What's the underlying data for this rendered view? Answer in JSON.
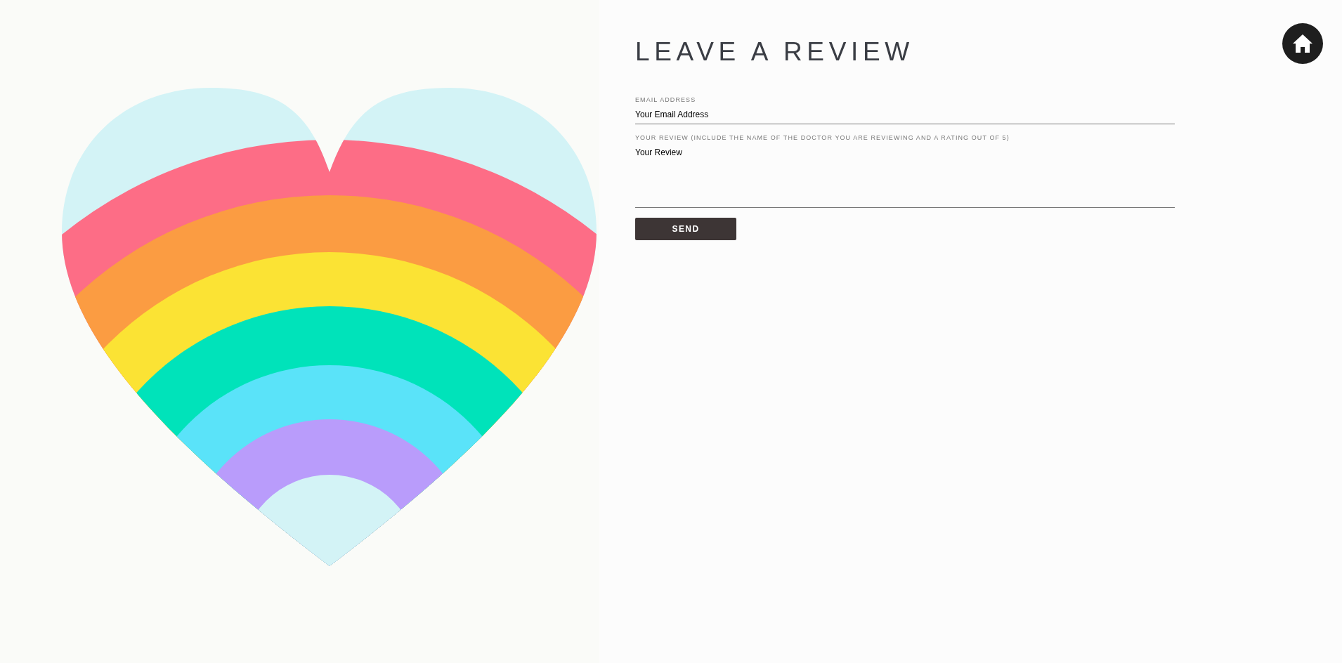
{
  "heading": "LEAVE A REVIEW",
  "fields": [
    {
      "kind": "input",
      "label": "EMAIL ADDRESS",
      "placeholder": "Your Email Address"
    },
    {
      "kind": "textarea",
      "label": "YOUR REVIEW (INCLUDE THE NAME OF THE DOCTOR YOU ARE REVIEWING AND A RATING OUT OF 5)",
      "placeholder": "Your Review"
    }
  ],
  "submit_button": "SEND",
  "home_button": {
    "kind": "home"
  }
}
